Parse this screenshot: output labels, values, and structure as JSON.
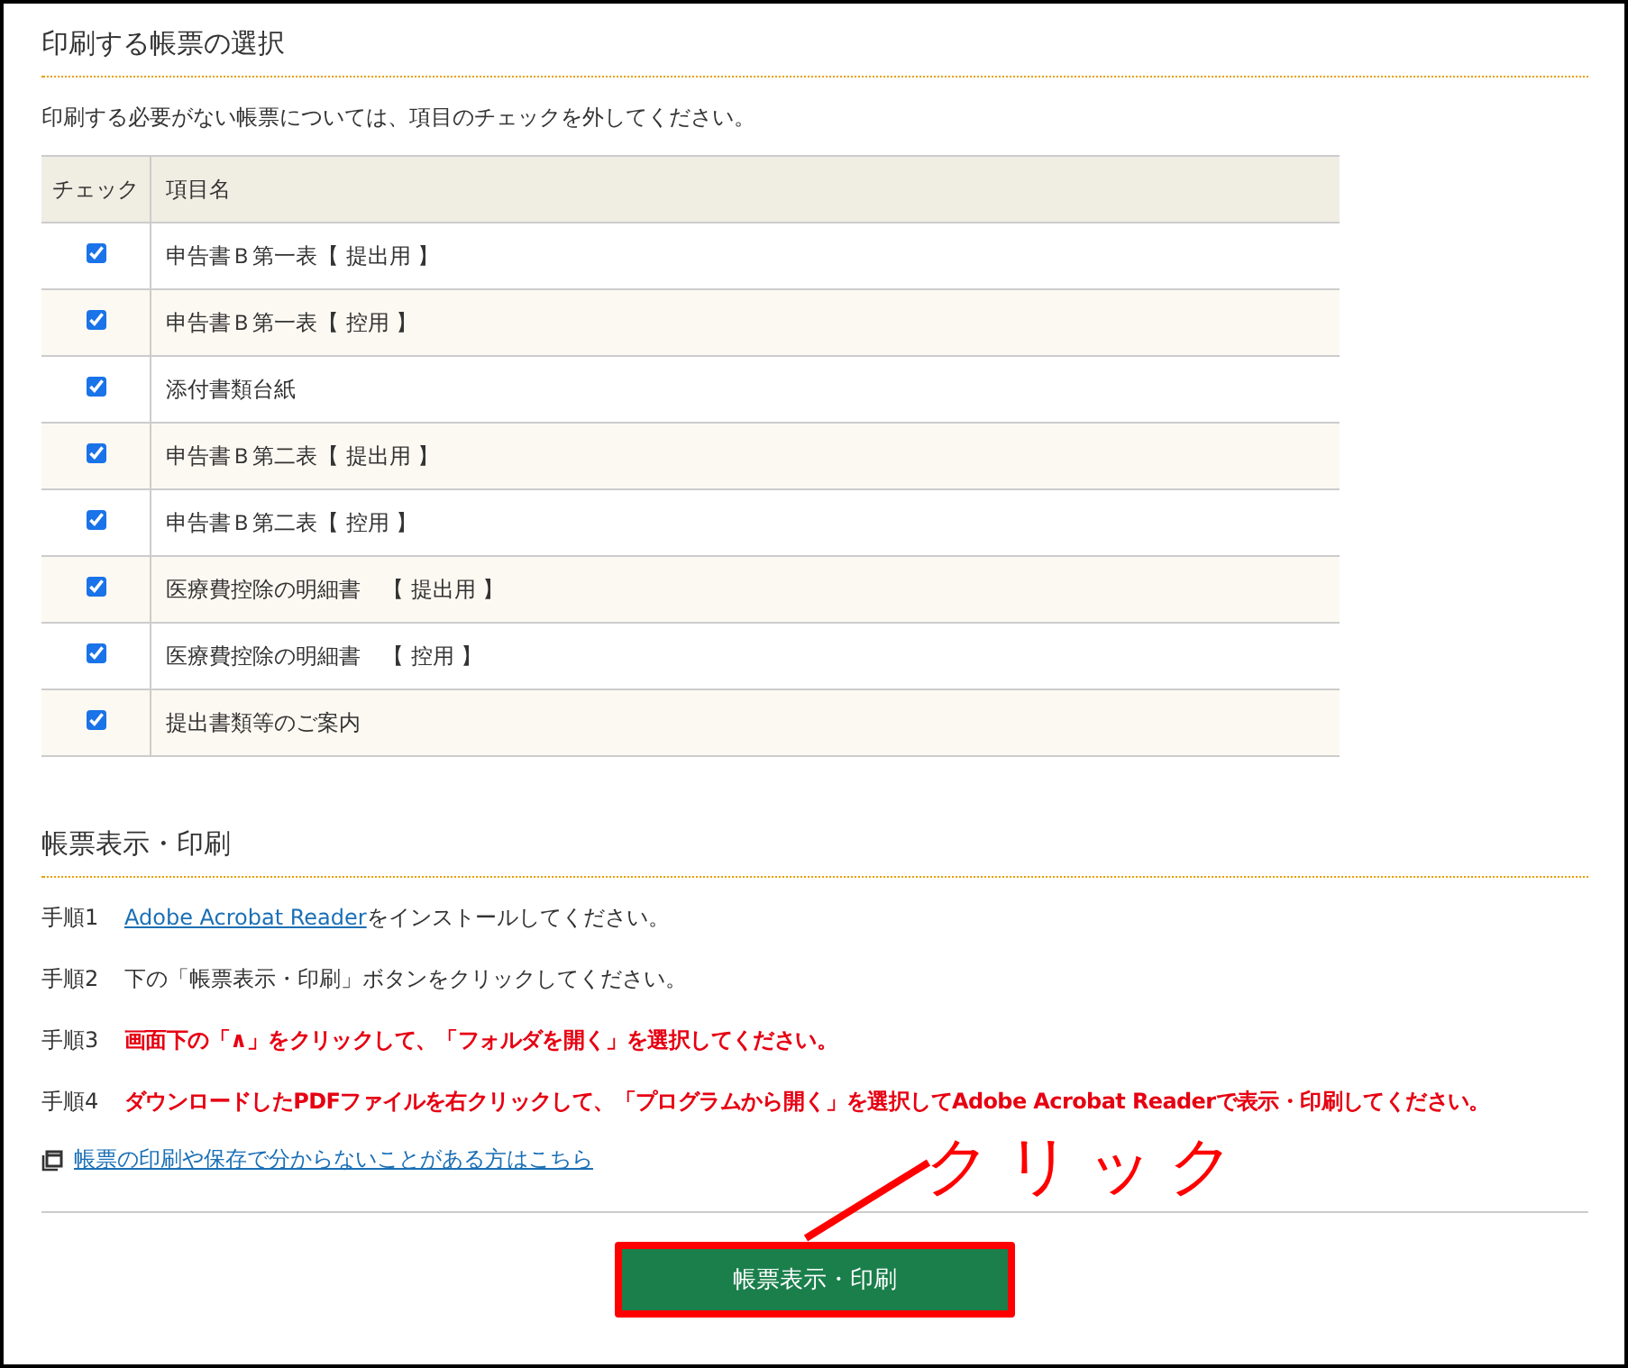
{
  "section1": {
    "title": "印刷する帳票の選択",
    "description": "印刷する必要がない帳票については、項目のチェックを外してください。"
  },
  "table": {
    "columns": [
      "チェック",
      "項目名"
    ],
    "rows": [
      {
        "name": "申告書Ｂ第一表【 提出用 】",
        "checked": true
      },
      {
        "name": "申告書Ｂ第一表【 控用 】",
        "checked": true
      },
      {
        "name": "添付書類台紙",
        "checked": true
      },
      {
        "name": "申告書Ｂ第二表【 提出用 】",
        "checked": true
      },
      {
        "name": "申告書Ｂ第二表【 控用 】",
        "checked": true
      },
      {
        "name": "医療費控除の明細書　【 提出用 】",
        "checked": true
      },
      {
        "name": "医療費控除の明細書　【 控用 】",
        "checked": true
      },
      {
        "name": "提出書類等のご案内",
        "checked": true
      }
    ]
  },
  "section2": {
    "title": "帳票表示・印刷"
  },
  "steps": [
    {
      "label": "手順1",
      "kind": "normal",
      "link": "Adobe Acrobat Reader",
      "text": "をインストールしてください。"
    },
    {
      "label": "手順2",
      "kind": "normal",
      "text": "下の「帳票表示・印刷」ボタンをクリックしてください。"
    },
    {
      "label": "手順3",
      "kind": "emphasis",
      "text": "画面下の「∧」をクリックして、「フォルダを開く」を選択してください。"
    },
    {
      "label": "手順4",
      "kind": "emphasis",
      "text": "ダウンロードしたPDFファイルを右クリックして、「プログラムから開く」を選択してAdobe Acrobat Readerで表示・印刷してください。"
    }
  ],
  "help_link": "帳票の印刷や保存で分からないことがある方はこちら",
  "button": {
    "label": "帳票表示・印刷",
    "highlighted": true
  },
  "annotation": {
    "text": "クリック"
  }
}
